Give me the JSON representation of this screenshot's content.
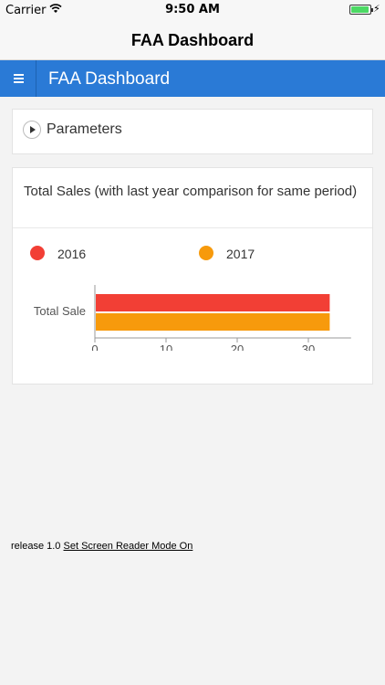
{
  "status_bar": {
    "carrier": "Carrier",
    "time": "9:50 AM"
  },
  "nav": {
    "title": "FAA Dashboard"
  },
  "header": {
    "title": "FAA Dashboard"
  },
  "parameters": {
    "label": "Parameters"
  },
  "sales_card": {
    "title": "Total Sales (with last year comparison for same period)"
  },
  "chart_data": {
    "type": "bar",
    "orientation": "horizontal",
    "categories": [
      "Total Sale"
    ],
    "series": [
      {
        "name": "2016",
        "values": [
          33
        ],
        "color": "#f23f35"
      },
      {
        "name": "2017",
        "values": [
          33
        ],
        "color": "#f79a0c"
      }
    ],
    "xlim": [
      0,
      36
    ],
    "xticks": [
      0,
      10,
      20,
      30
    ],
    "legend": "top"
  },
  "footer": {
    "release": "release 1.0",
    "link": "Set Screen Reader Mode On"
  }
}
